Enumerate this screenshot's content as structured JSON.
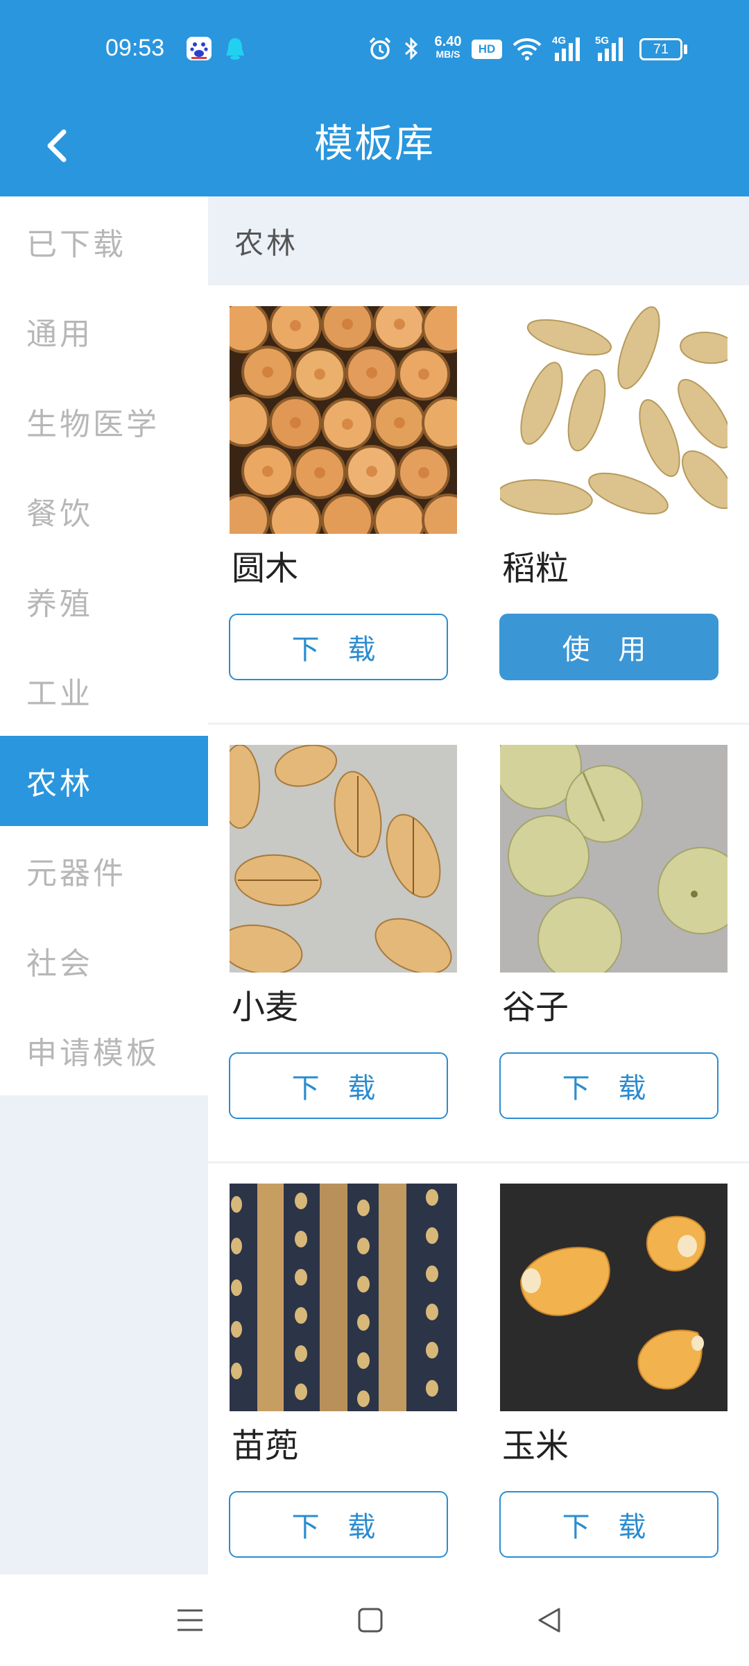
{
  "status_bar": {
    "time": "09:53",
    "speed_value": "6.40",
    "speed_unit": "MB/S",
    "hd_badge": "HD",
    "net1": "4G",
    "net2": "5G",
    "battery": "71",
    "icons": [
      "baidu-app-icon",
      "qq-bell-icon",
      "alarm-icon",
      "bluetooth-icon",
      "hd-icon",
      "wifi-icon",
      "signal-4g-icon",
      "signal-5g-icon",
      "battery-icon"
    ]
  },
  "header": {
    "title": "模板库",
    "back_icon": "chevron-left-icon"
  },
  "sidebar": {
    "items": [
      {
        "label": "已下载",
        "active": false
      },
      {
        "label": "通用",
        "active": false
      },
      {
        "label": "生物医学",
        "active": false
      },
      {
        "label": "餐饮",
        "active": false
      },
      {
        "label": "养殖",
        "active": false
      },
      {
        "label": "工业",
        "active": false
      },
      {
        "label": "农林",
        "active": true
      },
      {
        "label": "元器件",
        "active": false
      },
      {
        "label": "社会",
        "active": false
      },
      {
        "label": "申请模板",
        "active": false
      }
    ]
  },
  "content": {
    "section_title": "农林",
    "cards": [
      {
        "title": "圆木",
        "button": "下 载",
        "button_style": "outline",
        "image": "logs"
      },
      {
        "title": "稻粒",
        "button": "使 用",
        "button_style": "filled",
        "image": "rice"
      },
      {
        "title": "小麦",
        "button": "下 载",
        "button_style": "outline",
        "image": "wheat"
      },
      {
        "title": "谷子",
        "button": "下 载",
        "button_style": "outline",
        "image": "millet"
      },
      {
        "title": "苗蔸",
        "button": "下 载",
        "button_style": "outline",
        "image": "seedling"
      },
      {
        "title": "玉米",
        "button": "下 载",
        "button_style": "outline",
        "image": "corn"
      }
    ]
  },
  "system_nav": {
    "icons": [
      "menu-icon",
      "home-square-icon",
      "back-triangle-icon"
    ]
  },
  "colors": {
    "primary": "#2a96dd",
    "button_outline": "#2a8cd0",
    "sidebar_bg": "#ecf1f8",
    "inactive_text": "#b7b7b7"
  }
}
